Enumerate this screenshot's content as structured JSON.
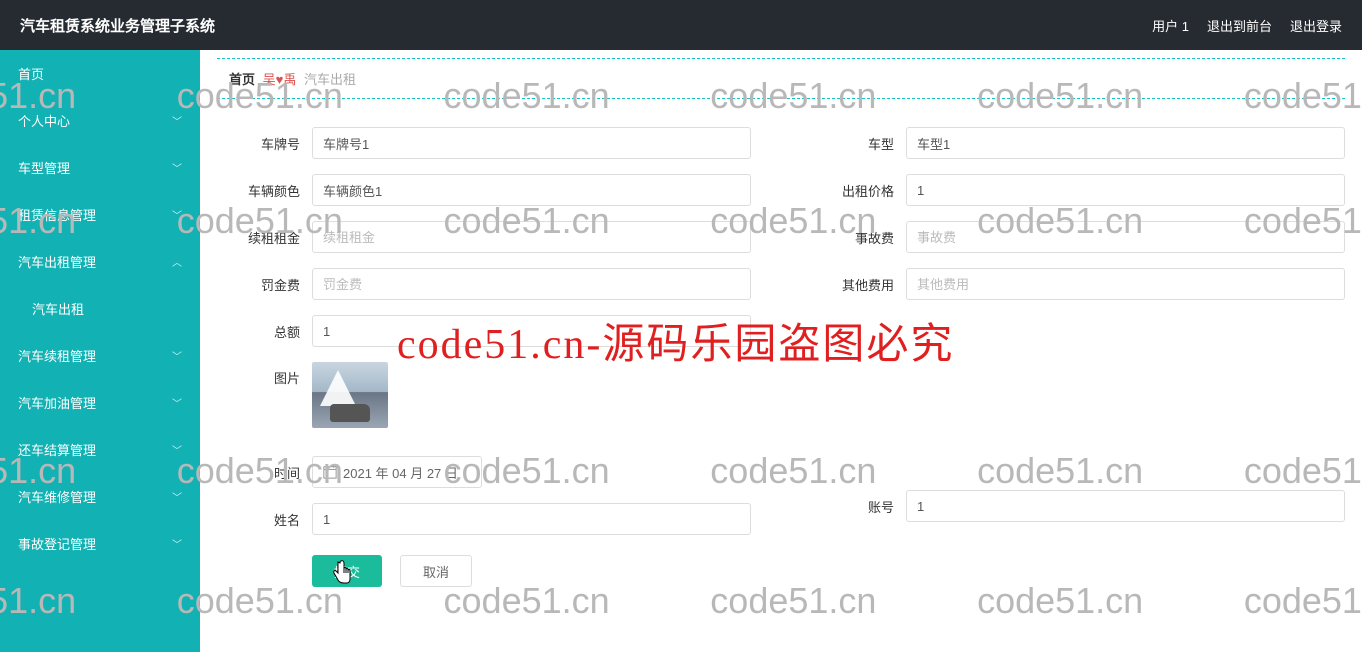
{
  "header": {
    "title": "汽车租赁系统业务管理子系统",
    "user": "用户 1",
    "to_front": "退出到前台",
    "logout": "退出登录"
  },
  "sidebar": {
    "items": [
      {
        "label": "首页",
        "expandable": false
      },
      {
        "label": "个人中心",
        "expandable": true
      },
      {
        "label": "车型管理",
        "expandable": true
      },
      {
        "label": "租赁信息管理",
        "expandable": true
      },
      {
        "label": "汽车出租管理",
        "expandable": true,
        "expanded": true,
        "children": [
          {
            "label": "汽车出租"
          }
        ]
      },
      {
        "label": "汽车续租管理",
        "expandable": true
      },
      {
        "label": "汽车加油管理",
        "expandable": true
      },
      {
        "label": "还车结算管理",
        "expandable": true
      },
      {
        "label": "汽车维修管理",
        "expandable": true
      },
      {
        "label": "事故登记管理",
        "expandable": true
      }
    ]
  },
  "breadcrumb": {
    "home": "首页",
    "current": "汽车出租"
  },
  "form": {
    "left": {
      "plate": {
        "label": "车牌号",
        "value": "车牌号1"
      },
      "color": {
        "label": "车辆颜色",
        "value": "车辆颜色1"
      },
      "renew": {
        "label": "续租租金",
        "placeholder": "续租租金"
      },
      "penalty": {
        "label": "罚金费",
        "placeholder": "罚金费"
      },
      "total": {
        "label": "总额",
        "value": "1"
      },
      "image": {
        "label": "图片"
      },
      "time": {
        "label": "时间",
        "value": "2021 年 04 月 27 日"
      },
      "name": {
        "label": "姓名",
        "value": "1"
      }
    },
    "right": {
      "type": {
        "label": "车型",
        "value": "车型1"
      },
      "price": {
        "label": "出租价格",
        "value": "1"
      },
      "accident": {
        "label": "事故费",
        "placeholder": "事故费"
      },
      "other": {
        "label": "其他费用",
        "placeholder": "其他费用"
      },
      "account": {
        "label": "账号",
        "value": "1"
      }
    }
  },
  "buttons": {
    "submit": "提交",
    "cancel": "取消"
  },
  "watermark": {
    "text": "code51.cn",
    "center": "code51.cn-源码乐园盗图必究"
  }
}
